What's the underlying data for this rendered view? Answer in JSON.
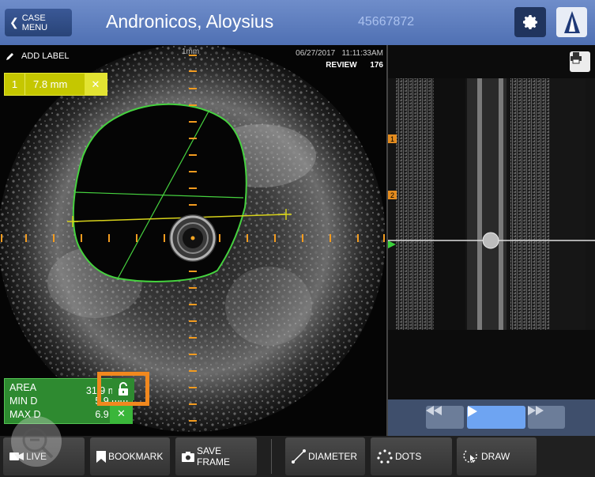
{
  "header": {
    "back_label": "CASE MENU",
    "patient_name": "Andronicos, Aloysius",
    "patient_id": "45667872"
  },
  "ivus": {
    "add_label": "ADD LABEL",
    "scale_label": "1mm",
    "date": "06/27/2017",
    "time": "11:11:33AM",
    "mode": "REVIEW",
    "frame": "176",
    "measurement": {
      "index": "1",
      "value": "7.8 mm"
    },
    "area": {
      "area_key": "AREA",
      "area_value": "31.9 mm",
      "min_key": "MIN D",
      "min_value": "5.9 mm",
      "max_key": "MAX D",
      "max_value": "6.9 mm",
      "superscript": "2"
    }
  },
  "longitudinal": {
    "bookmarks": [
      "1",
      "2"
    ]
  },
  "toolbar": {
    "live": "LIVE",
    "bookmark": "BOOKMARK",
    "save_frame": "SAVE FRAME",
    "diameter": "DIAMETER",
    "dots": "DOTS",
    "draw": "DRAW"
  },
  "colors": {
    "header": "#5b7cbf",
    "contour": "#46d23f",
    "measure": "#d7d21a",
    "highlight": "#f1881e",
    "playback": "#6ea4f2"
  },
  "icons": [
    "chevron-left-icon",
    "gear-icon",
    "catheter-logo-icon",
    "pencil-icon",
    "close-icon",
    "lock-open-icon",
    "print-icon",
    "rewind-icon",
    "play-icon",
    "fast-forward-icon",
    "camera-icon",
    "bookmark-icon",
    "save-frame-icon",
    "diameter-icon",
    "dots-icon",
    "draw-icon",
    "magnifier-icon"
  ]
}
